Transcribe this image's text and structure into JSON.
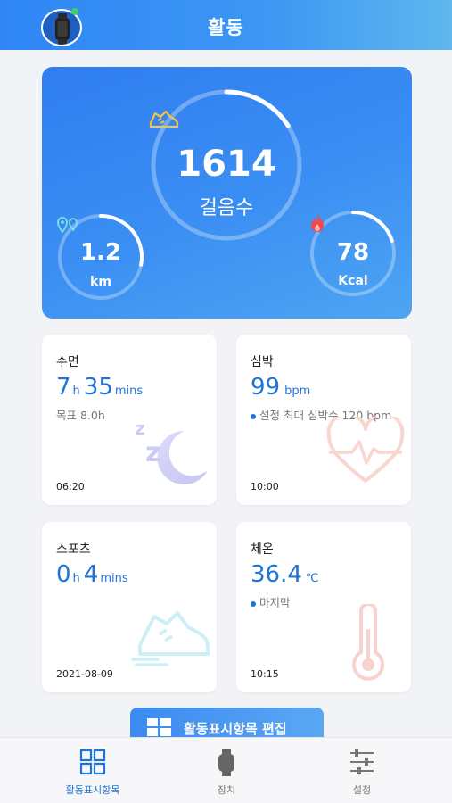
{
  "header": {
    "title": "활동"
  },
  "activity": {
    "steps": {
      "value": "1614",
      "label": "걸음수",
      "progress": 0.16
    },
    "distance": {
      "value": "1.2",
      "unit": "km",
      "progress": 0.28
    },
    "calories": {
      "value": "78",
      "unit": "Kcal",
      "progress": 0.2
    }
  },
  "cards": {
    "sleep": {
      "title": "수면",
      "hours": "7",
      "h_unit": "h",
      "minutes": "35",
      "m_unit": "mins",
      "goal": "목표 8.0h",
      "time": "06:20"
    },
    "heart": {
      "title": "심박",
      "value": "99",
      "unit": "bpm",
      "note": "설정 최대 심박수 120 bpm",
      "time": "10:00"
    },
    "sports": {
      "title": "스포츠",
      "hours": "0",
      "h_unit": "h",
      "minutes": "4",
      "m_unit": "mins",
      "date": "2021-08-09"
    },
    "temp": {
      "title": "체온",
      "value": "36.4",
      "unit": "℃",
      "note": "마지막",
      "time": "10:15"
    }
  },
  "edit_button": {
    "label": "활동표시항목 편집"
  },
  "bottom_nav": {
    "items": [
      {
        "label": "활동표시항목",
        "icon": "grid-icon"
      },
      {
        "label": "장치",
        "icon": "watch-icon"
      },
      {
        "label": "설정",
        "icon": "sliders-icon"
      }
    ]
  },
  "colors": {
    "accent": "#1e73d8",
    "header_start": "#2f86f6",
    "header_end": "#5fb7ee"
  }
}
